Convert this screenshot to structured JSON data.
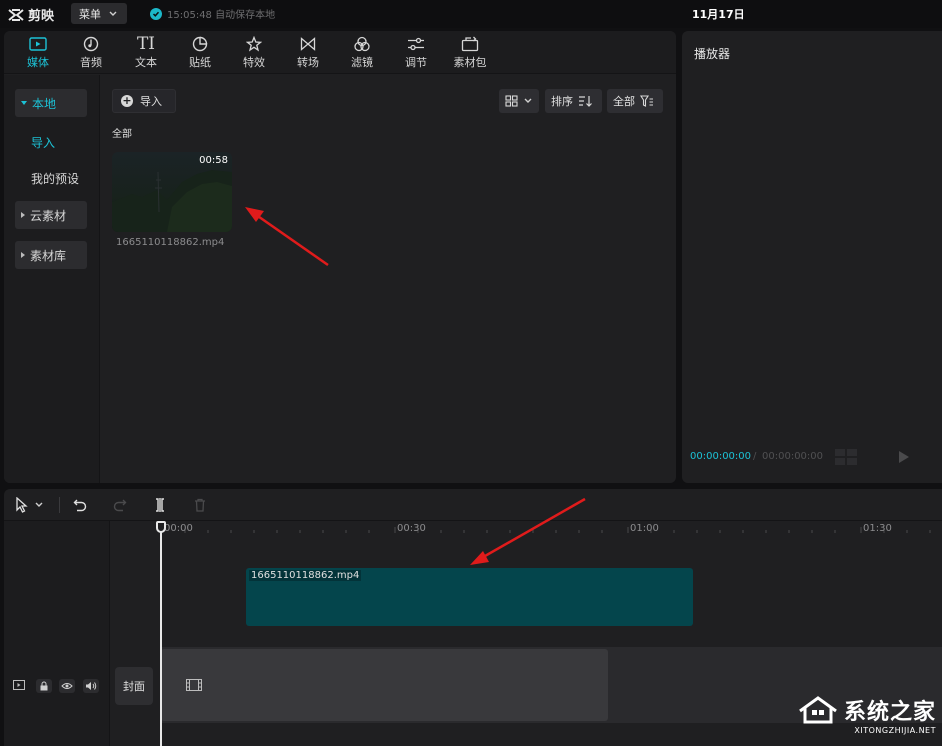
{
  "app": {
    "name": "剪映",
    "menu_label": "菜单",
    "autosave_text": "15:05:48 自动保存本地",
    "date": "11月17日"
  },
  "toolbar": {
    "items": [
      {
        "label": "媒体",
        "icon": "media-icon"
      },
      {
        "label": "音频",
        "icon": "audio-icon"
      },
      {
        "label": "文本",
        "icon": "text-icon"
      },
      {
        "label": "贴纸",
        "icon": "sticker-icon"
      },
      {
        "label": "特效",
        "icon": "effects-icon"
      },
      {
        "label": "转场",
        "icon": "transition-icon"
      },
      {
        "label": "滤镜",
        "icon": "filter-icon"
      },
      {
        "label": "调节",
        "icon": "adjust-icon"
      },
      {
        "label": "素材包",
        "icon": "package-icon"
      }
    ],
    "text_icon_glyph": "TI"
  },
  "sidebar": {
    "items": [
      {
        "label": "本地"
      },
      {
        "label": "导入"
      },
      {
        "label": "我的预设"
      },
      {
        "label": "云素材"
      },
      {
        "label": "素材库"
      }
    ]
  },
  "media": {
    "import_label": "导入",
    "sort_label": "排序",
    "filter_label": "全部",
    "section_label": "全部",
    "clip": {
      "duration": "00:58",
      "filename": "1665110118862.mp4"
    }
  },
  "player": {
    "title": "播放器",
    "current_time": "00:00:00:00",
    "total_time": "00:00:00:00"
  },
  "timeline": {
    "ruler": [
      "00:00",
      "00:30",
      "01:00",
      "01:30"
    ],
    "clip_label": "1665110118862.mp4",
    "cover_label": "封面"
  },
  "watermark": {
    "main": "系统之家",
    "sub": "XITONGZHIJIA.NET"
  },
  "colors": {
    "accent": "#1cc2d6",
    "clip_track": "#04454c",
    "arrow": "#e01b1b"
  }
}
